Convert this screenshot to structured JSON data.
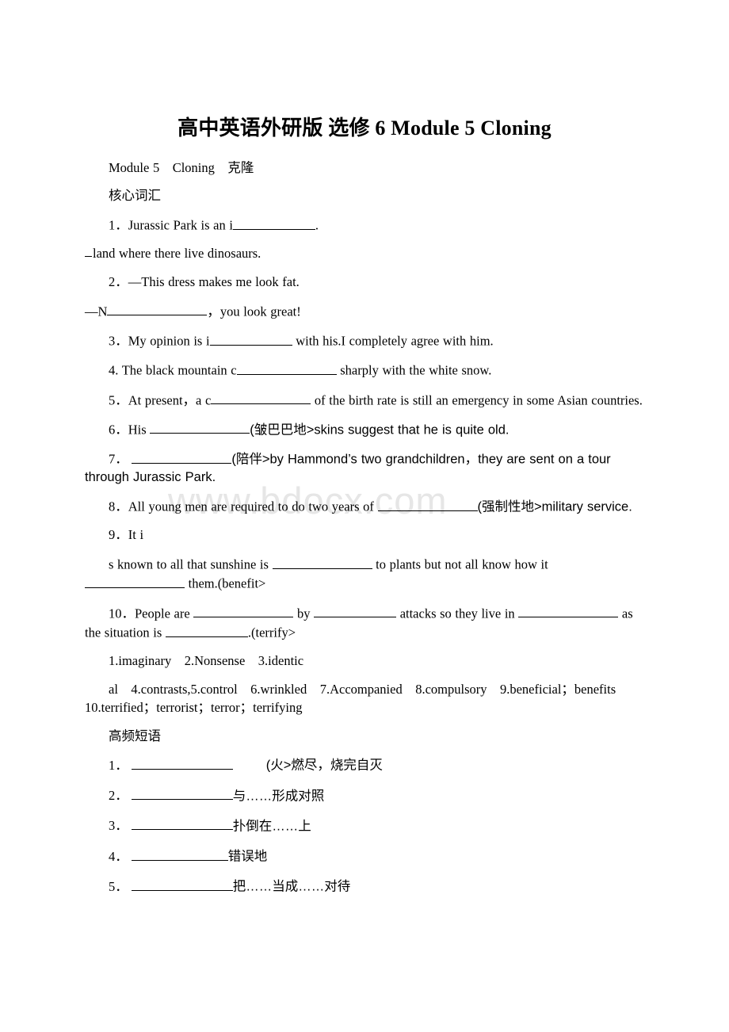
{
  "document": {
    "title": "高中英语外研版 选修 6 Module 5 Cloning",
    "watermark": "www.bdocx.com",
    "subtitle": "Module 5　Cloning　克隆",
    "section_core_vocab": "核心词汇",
    "section_phrases": "高频短语"
  },
  "core_vocab": {
    "q1_a": "1．Jurassic Park is an i",
    "q1_a_tail": ".",
    "q1_b": "land where there live dinosaurs.",
    "q2_a": "2．—This dress makes me look fat.",
    "q2_b_pre": "—N",
    "q2_b_post": "，you look great!",
    "q3_pre": "3．My opinion is i",
    "q3_post": "with his.I completely agree with him.",
    "q4_pre": "4. The black mountain c",
    "q4_post": "sharply with the white snow.",
    "q5_pre": "5．At present，a c",
    "q5_post": "of the birth rate is still an emergency in some Asian countries.",
    "q6_pre": "6．His",
    "q6_post": "(皱巴巴地>skins suggest that he is quite old.",
    "q7_pre": "7．",
    "q7_post": "(陪伴>by Hammond’s two grandchildren，they are sent on a tour through Jurassic Park.",
    "q8_pre": "8．All young men are required to do two years of",
    "q8_post": "(强制性地>military service.",
    "q9_a": "9．It i",
    "q9_b_pre": "s known to all that sunshine is",
    "q9_b_mid": "to plants but not all know how it",
    "q9_b_post": "them.(benefit>",
    "q10_pre": "10．People are",
    "q10_mid1": "by",
    "q10_mid2": "attacks so they live in",
    "q10_mid3": "as the situation is",
    "q10_post": ".(terrify>"
  },
  "answer_key": {
    "line1": "1.imaginary　2.Nonsense　3.identic",
    "line2": "al　4.contrasts,5.control　6.wrinkled　7.Accompanied　8.compulsory　9.beneficial；benefits　10.terrified；terrorist；terror；terrifying"
  },
  "phrases": [
    {
      "num": "1．",
      "meaning": "(火>燃尽，烧完自灭",
      "gap_before_meaning": true
    },
    {
      "num": "2．",
      "meaning": "与……形成对照",
      "gap_before_meaning": false
    },
    {
      "num": "3．",
      "meaning": "扑倒在……上",
      "gap_before_meaning": false
    },
    {
      "num": "4．",
      "meaning": "错误地",
      "gap_before_meaning": false
    },
    {
      "num": "5．",
      "meaning": "把……当成……对待",
      "gap_before_meaning": false
    }
  ]
}
